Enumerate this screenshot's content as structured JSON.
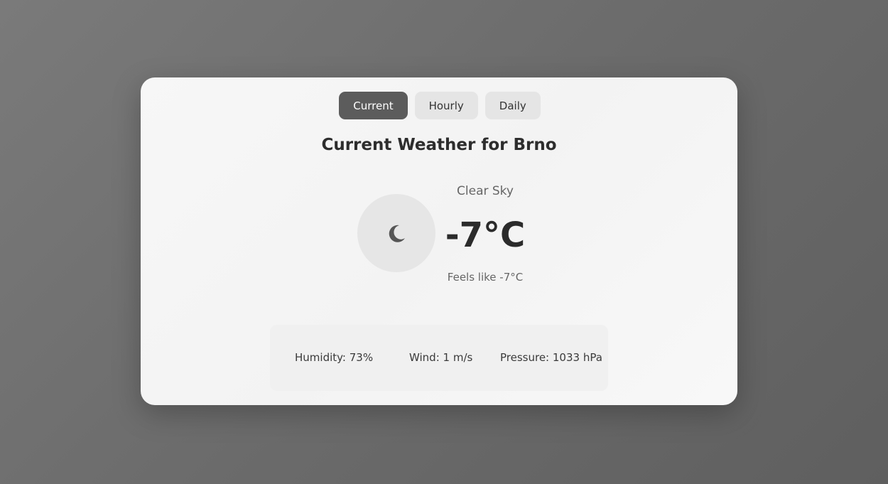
{
  "tabs": [
    {
      "label": "Current",
      "active": true
    },
    {
      "label": "Hourly",
      "active": false
    },
    {
      "label": "Daily",
      "active": false
    }
  ],
  "title": "Current Weather for Brno",
  "weather": {
    "icon": "moon-icon",
    "condition": "Clear Sky",
    "temperature": "-7°C",
    "feels_like": "Feels like -7°C"
  },
  "details": {
    "humidity": "Humidity: 73%",
    "wind": "Wind: 1 m/s",
    "pressure": "Pressure: 1033 hPa"
  },
  "colors": {
    "active_tab": "#5c5c5c",
    "inactive_tab": "#e5e5e5",
    "card": "#f5f5f5",
    "background": "#6b6b6b"
  }
}
